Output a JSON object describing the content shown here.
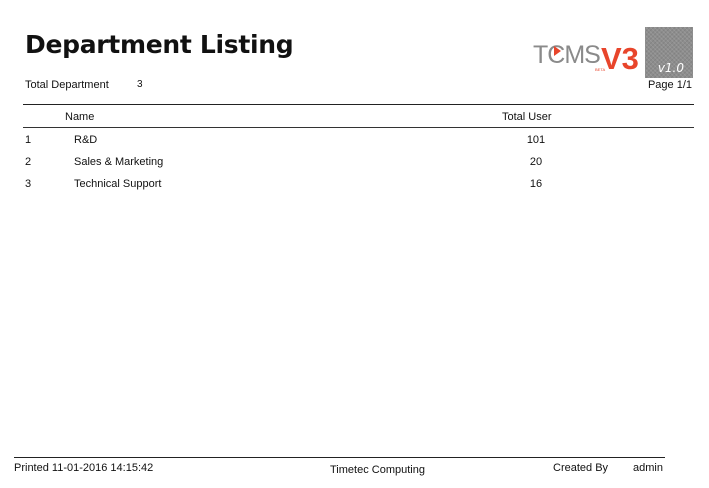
{
  "report": {
    "title": "Department Listing",
    "summary_label": "Total Department",
    "summary_value": "3",
    "page": "Page 1/1"
  },
  "brand": {
    "logo_text": "TCMS",
    "logo_version_mark": "V3",
    "logo_beta": "BETA",
    "version": "v1.0",
    "accent_color": "#e8452b",
    "logo_gray": "#8a8a8a",
    "badge_color": "#8d8d8d"
  },
  "table": {
    "headers": {
      "name": "Name",
      "total_user": "Total User"
    },
    "rows": [
      {
        "no": "1",
        "name": "R&D",
        "total": "101"
      },
      {
        "no": "2",
        "name": "Sales & Marketing",
        "total": "20"
      },
      {
        "no": "3",
        "name": "Technical Support",
        "total": "16"
      }
    ]
  },
  "footer": {
    "printed": "Printed 11-01-2016 14:15:42",
    "company": "Timetec Computing",
    "created_by_label": "Created By",
    "created_by_value": "admin"
  }
}
